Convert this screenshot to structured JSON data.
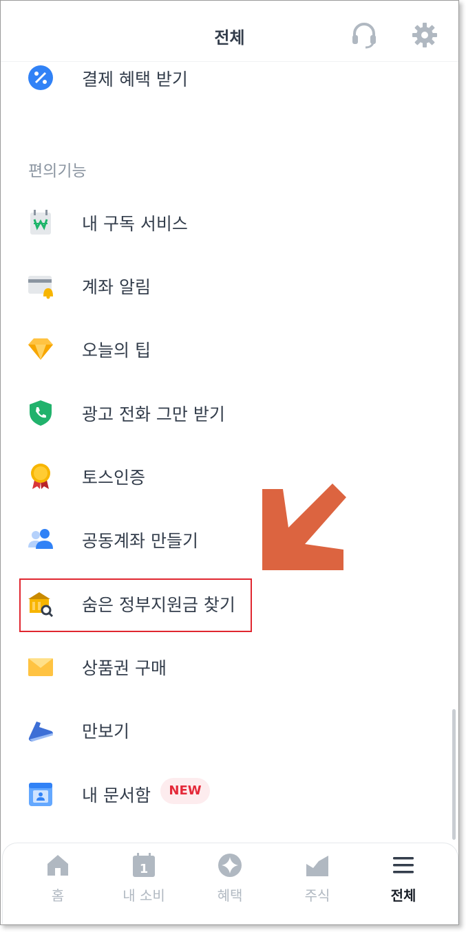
{
  "header": {
    "title": "전체",
    "support_icon": "headset-icon",
    "settings_icon": "gear-icon"
  },
  "menu_top": {
    "label": "결제 혜택 받기",
    "icon": "percent-badge-icon"
  },
  "section": {
    "title": "편의기능",
    "items": [
      {
        "label": "내 구독 서비스",
        "icon": "calendar-won-icon"
      },
      {
        "label": "계좌 알림",
        "icon": "card-bell-icon"
      },
      {
        "label": "오늘의 팁",
        "icon": "diamond-icon"
      },
      {
        "label": "광고 전화 그만 받기",
        "icon": "shield-phone-icon"
      },
      {
        "label": "토스인증",
        "icon": "medal-icon"
      },
      {
        "label": "공동계좌 만들기",
        "icon": "people-icon"
      },
      {
        "label": "숨은 정부지원금 찾기",
        "icon": "bank-search-icon"
      },
      {
        "label": "상품권 구매",
        "icon": "envelope-icon"
      },
      {
        "label": "만보기",
        "icon": "sneaker-icon"
      },
      {
        "label": "내 문서함",
        "icon": "document-box-icon",
        "badge": "NEW"
      }
    ]
  },
  "tabbar": {
    "tabs": [
      {
        "label": "홈",
        "icon": "home-icon",
        "active": false
      },
      {
        "label": "내 소비",
        "icon": "calendar-icon",
        "active": false
      },
      {
        "label": "혜택",
        "icon": "sparkle-icon",
        "active": false
      },
      {
        "label": "주식",
        "icon": "chart-icon",
        "active": false
      },
      {
        "label": "전체",
        "icon": "menu-icon",
        "active": true
      }
    ]
  },
  "colors": {
    "accent_blue": "#3182f6",
    "highlight_red": "#e0262f",
    "arrow_orange": "#dc6440",
    "badge_red": "#e42939"
  }
}
